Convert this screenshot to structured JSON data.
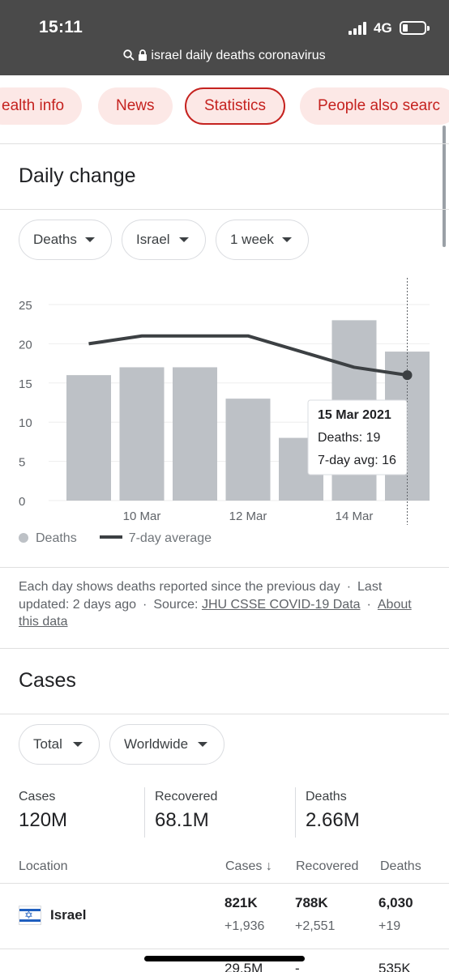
{
  "status_bar": {
    "time": "15:11",
    "network": "4G"
  },
  "url_bar": {
    "query": "israel daily deaths coronavirus"
  },
  "chips": [
    "ealth info",
    "News",
    "Statistics",
    "People also searc"
  ],
  "daily_change": {
    "title": "Daily change",
    "filters": {
      "metric": "Deaths",
      "location": "Israel",
      "range": "1 week"
    },
    "tooltip": {
      "date": "15 Mar 2021",
      "deaths": "Deaths: 19",
      "avg": "7-day avg: 16"
    },
    "legend": {
      "bars": "Deaths",
      "line": "7-day average"
    },
    "note": "Each day shows deaths reported since the previous day",
    "last_updated": "Last updated: 2 days ago",
    "source_label": "Source:",
    "source_link": "JHU CSSE COVID-19 Data",
    "about_link": "About this data"
  },
  "chart_data": {
    "type": "bar",
    "categories": [
      "9 Mar",
      "10 Mar",
      "11 Mar",
      "12 Mar",
      "13 Mar",
      "14 Mar",
      "15 Mar"
    ],
    "x_tick_labels": [
      "10 Mar",
      "12 Mar",
      "14 Mar"
    ],
    "series": [
      {
        "name": "Deaths",
        "type": "bar",
        "values": [
          16,
          17,
          17,
          13,
          8,
          23,
          19
        ]
      },
      {
        "name": "7-day average",
        "type": "line",
        "values": [
          20,
          21,
          21,
          21,
          19,
          17,
          16
        ]
      }
    ],
    "yticks": [
      0,
      5,
      10,
      15,
      20,
      25
    ],
    "ylim": [
      0,
      25
    ],
    "grid": true,
    "highlight_index": 6
  },
  "cases": {
    "title": "Cases",
    "filters": {
      "type": "Total",
      "scope": "Worldwide"
    },
    "summary": [
      {
        "label": "Cases",
        "value": "120M"
      },
      {
        "label": "Recovered",
        "value": "68.1M"
      },
      {
        "label": "Deaths",
        "value": "2.66M"
      }
    ],
    "table": {
      "headers": {
        "location": "Location",
        "cases": "Cases",
        "recovered": "Recovered",
        "deaths": "Deaths"
      },
      "rows": [
        {
          "location": "Israel",
          "cases": "821K",
          "cases_delta": "+1,936",
          "recovered": "788K",
          "recovered_delta": "+2,551",
          "deaths": "6,030",
          "deaths_delta": "+19"
        },
        {
          "location": "",
          "cases": "29.5M",
          "recovered": "-",
          "deaths": "535K"
        }
      ]
    }
  }
}
